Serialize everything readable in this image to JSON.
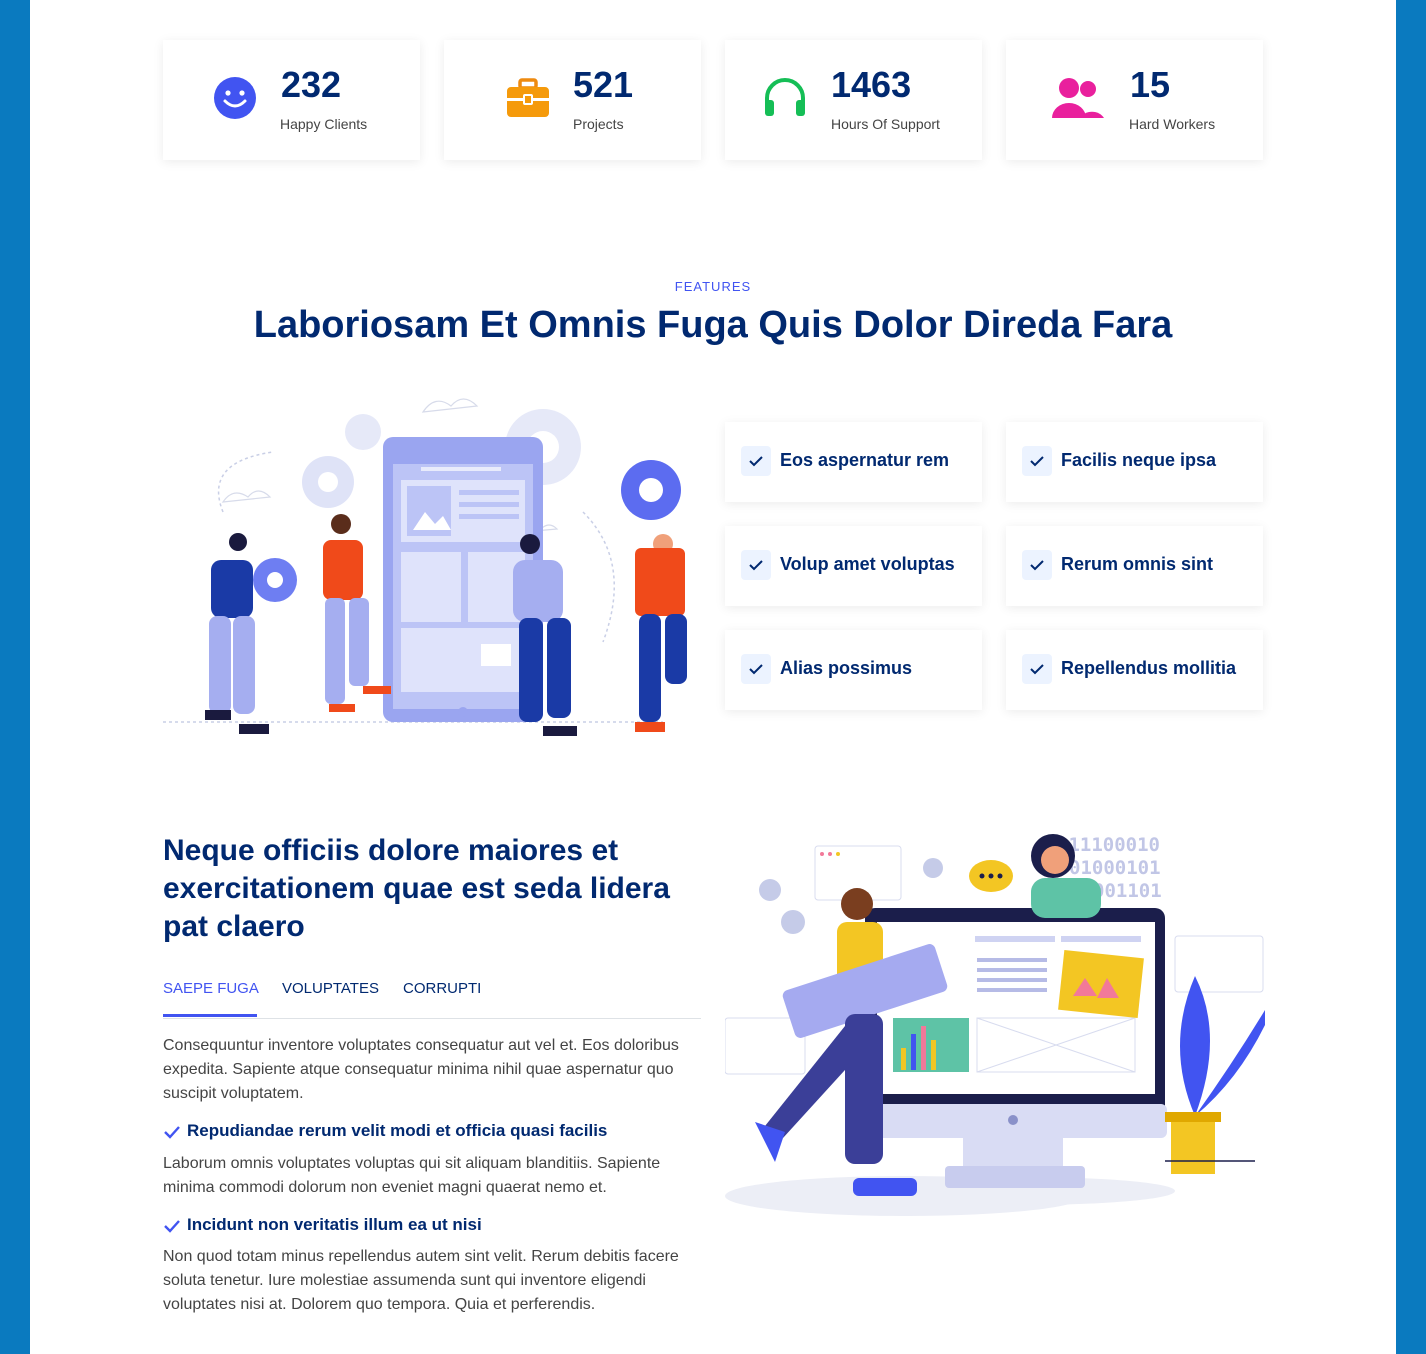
{
  "stats": [
    {
      "icon": "smile-icon",
      "number": "232",
      "label": "Happy Clients",
      "color": "#4154f1"
    },
    {
      "icon": "briefcase-icon",
      "number": "521",
      "label": "Projects",
      "color": "#ee6c20"
    },
    {
      "icon": "headset-icon",
      "number": "1463",
      "label": "Hours Of Support",
      "color": "#15be56"
    },
    {
      "icon": "people-icon",
      "number": "15",
      "label": "Hard Workers",
      "color": "#bb0852"
    }
  ],
  "features": {
    "eyebrow": "FEATURES",
    "title": "Laboriosam Et Omnis Fuga Quis Dolor Direda Fara",
    "items": [
      "Eos aspernatur rem",
      "Facilis neque ipsa",
      "Volup amet voluptas",
      "Rerum omnis sint",
      "Alias possimus",
      "Repellendus mollitia"
    ]
  },
  "details": {
    "title": "Neque officiis dolore maiores et exercitationem quae est seda lidera pat claero",
    "tabs": [
      "SAEPE FUGA",
      "VOLUPTATES",
      "CORRUPTI"
    ],
    "active_tab": "SAEPE FUGA",
    "intro": "Consequuntur inventore voluptates consequatur aut vel et. Eos doloribus expedita. Sapiente atque consequatur minima nihil quae aspernatur quo suscipit voluptatem.",
    "points": [
      {
        "heading": "Repudiandae rerum velit modi et officia quasi facilis",
        "text": "Laborum omnis voluptates voluptas qui sit aliquam blanditiis. Sapiente minima commodi dolorum non eveniet magni quaerat nemo et."
      },
      {
        "heading": "Incidunt non veritatis illum ea ut nisi",
        "text": "Non quod totam minus repellendus autem sint velit. Rerum debitis facere soluta tenetur. Iure molestiae assumenda sunt qui inventore eligendi voluptates nisi at. Dolorem quo tempora. Quia et perferendis."
      }
    ]
  },
  "illustration_binary": [
    "011100010",
    "01000101",
    "001101"
  ]
}
